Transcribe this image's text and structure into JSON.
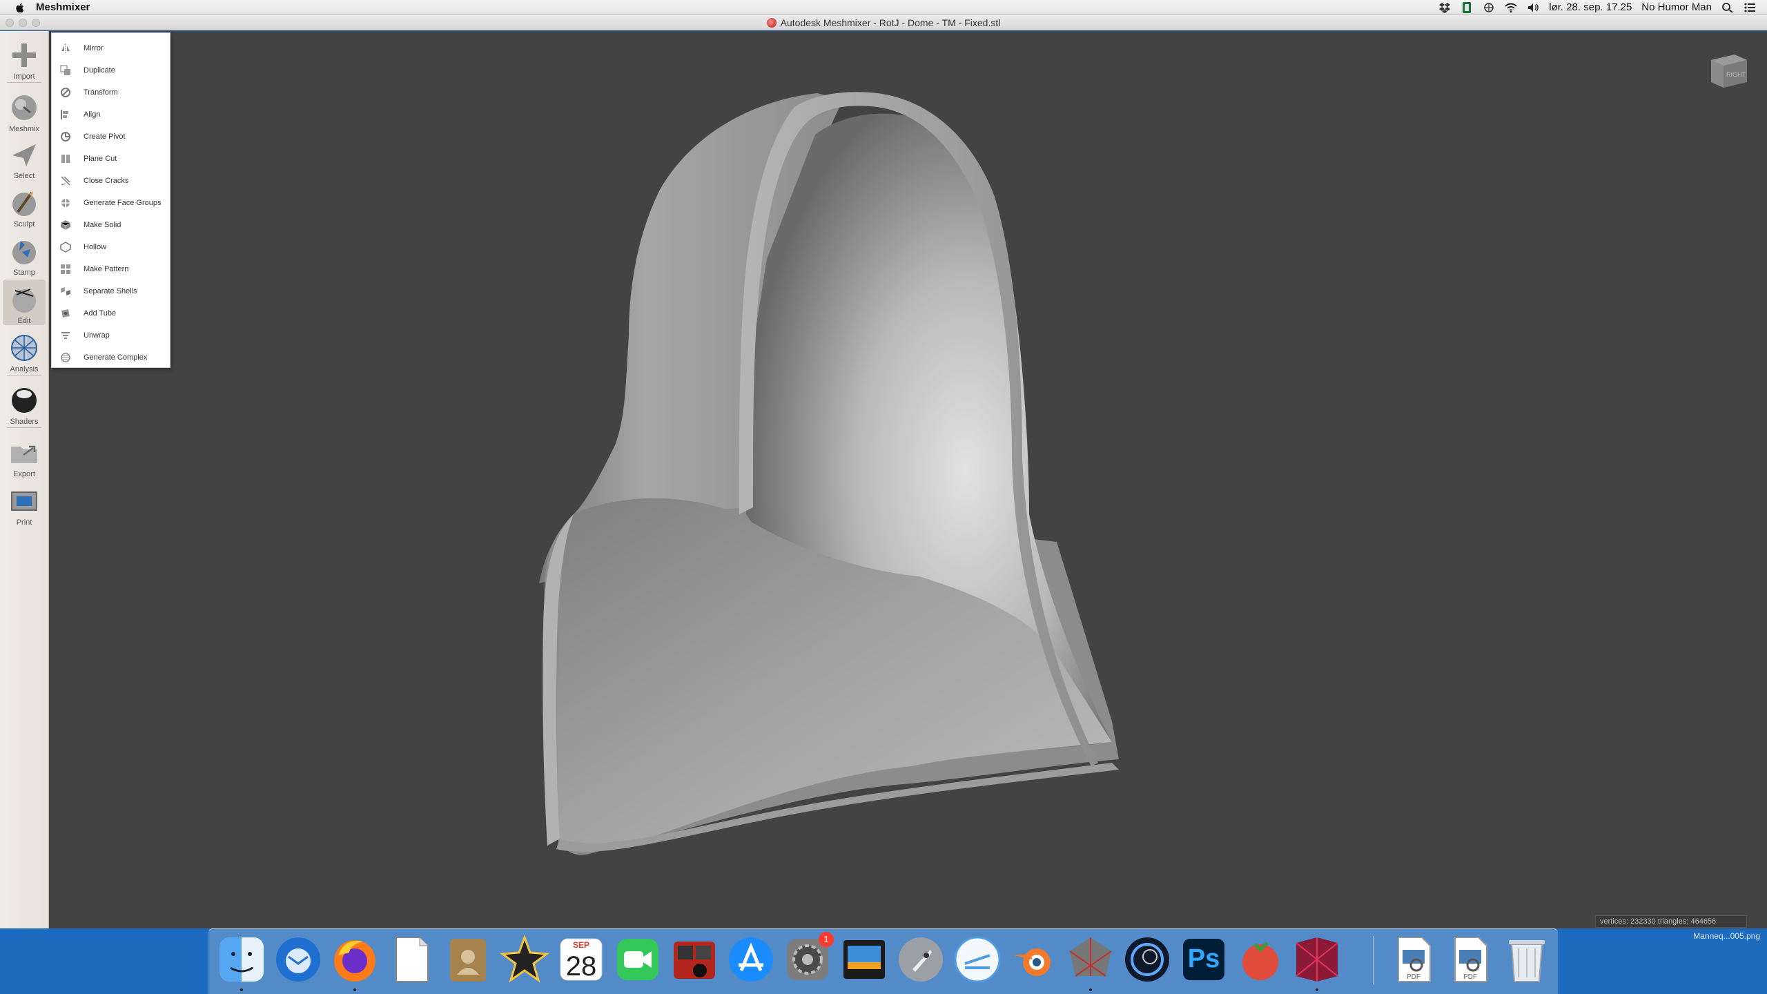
{
  "menubar": {
    "app_name": "Meshmixer",
    "datetime": "lør. 28. sep. 17.25",
    "user": "No Humor Man"
  },
  "window": {
    "title": "Autodesk Meshmixer - RotJ - Dome - TM - Fixed.stl"
  },
  "toolbar": {
    "tools": [
      {
        "label": "Import",
        "icon": "plus-icon"
      },
      {
        "label": "Meshmix",
        "icon": "meshmix-icon"
      },
      {
        "label": "Select",
        "icon": "select-arrow-icon"
      },
      {
        "label": "Sculpt",
        "icon": "brush-icon"
      },
      {
        "label": "Stamp",
        "icon": "stamp-icon"
      },
      {
        "label": "Edit",
        "icon": "edit-icon"
      },
      {
        "label": "Analysis",
        "icon": "analysis-icon"
      },
      {
        "label": "Shaders",
        "icon": "shader-sphere-icon"
      },
      {
        "label": "Export",
        "icon": "export-folder-icon"
      },
      {
        "label": "Print",
        "icon": "printer-icon"
      }
    ],
    "active": "Edit"
  },
  "edit_menu": {
    "items": [
      "Mirror",
      "Duplicate",
      "Transform",
      "Align",
      "Create Pivot",
      "Plane Cut",
      "Close Cracks",
      "Generate Face Groups",
      "Make Solid",
      "Hollow",
      "Make Pattern",
      "Separate Shells",
      "Add Tube",
      "Unwrap",
      "Generate Complex"
    ]
  },
  "viewport": {
    "viewcube_label": "RIGHT",
    "stats": "vertices: 232330 triangles: 464656",
    "background_color": "#434343",
    "model_color": "#a9a9a9"
  },
  "dock": {
    "calendar_month": "SEP",
    "calendar_day": "28",
    "system_prefs_badge": "1",
    "photoshop_label": "Ps",
    "pdf_label": "PDF",
    "apps": [
      "Finder",
      "Thunderbird",
      "Firefox",
      "TextEdit",
      "Contacts",
      "iMovie",
      "Calendar",
      "FaceTime",
      "Photo Booth",
      "App Store",
      "System Preferences",
      "Screens",
      "Launchpad",
      "Mac Linkstation",
      "Blender",
      "Polyhedron",
      "Cinema 4D",
      "Photoshop",
      "Affinity",
      "Magic",
      "Document",
      "Document",
      "Trash"
    ]
  },
  "desktop_file": "Manneq...005.png"
}
